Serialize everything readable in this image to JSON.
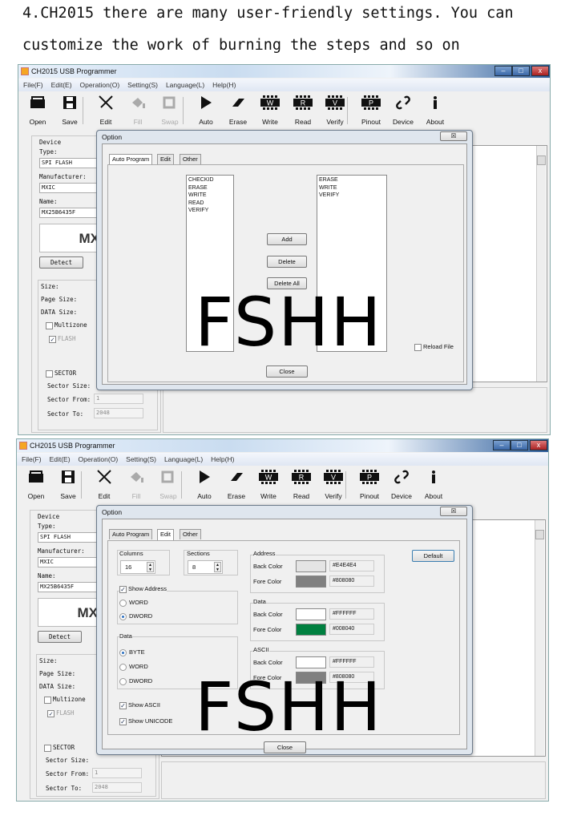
{
  "heading": {
    "line1": "4.CH2015 there are many user-friendly settings. You can",
    "line2": "customize the work of burning the steps and so on"
  },
  "app": {
    "title": "CH2015 USB Programmer",
    "window_controls": [
      "–",
      "□",
      "x"
    ],
    "menu": [
      "File(F)",
      "Edit(E)",
      "Operation(O)",
      "Setting(S)",
      "Language(L)",
      "Help(H)"
    ],
    "toolbar": [
      {
        "label": "Open",
        "icon": "folder-open-icon",
        "disabled": false
      },
      {
        "label": "Save",
        "icon": "floppy-save-icon",
        "disabled": false
      },
      {
        "label": "Edit",
        "icon": "edit-tools-icon",
        "disabled": false
      },
      {
        "label": "Fill",
        "icon": "fill-bucket-icon",
        "disabled": true
      },
      {
        "label": "Swap",
        "icon": "swap-icon",
        "disabled": true
      },
      {
        "label": "Auto",
        "icon": "play-icon",
        "disabled": false
      },
      {
        "label": "Erase",
        "icon": "eraser-icon",
        "disabled": false
      },
      {
        "label": "Write",
        "icon": "chip-w-icon",
        "chip": "W",
        "disabled": false
      },
      {
        "label": "Read",
        "icon": "chip-r-icon",
        "chip": "R",
        "disabled": false
      },
      {
        "label": "Verify",
        "icon": "chip-v-icon",
        "chip": "V",
        "disabled": false
      },
      {
        "label": "Pinout",
        "icon": "chip-p-icon",
        "chip": "P",
        "disabled": false
      },
      {
        "label": "Device",
        "icon": "link-icon",
        "disabled": false
      },
      {
        "label": "About",
        "icon": "info-icon",
        "disabled": false
      }
    ],
    "device": {
      "group_label": "Device",
      "type_label": "Type:",
      "type_value": "SPI FLASH",
      "manufacturer_label": "Manufacturer:",
      "manufacturer_value": "MXIC",
      "name_label": "Name:",
      "name_value": "MX25B6435F",
      "logo": "MX",
      "detect": "Detect",
      "size_label": "Size:",
      "page_size_label": "Page Size:",
      "data_size_label": "DATA Size:",
      "multizone": "Multizone",
      "flash": "FLASH",
      "sector": "SECTOR",
      "sector_size_label": "Sector Size:",
      "sector_from_label": "Sector From:",
      "sector_from_value": "1",
      "sector_to_label": "Sector To:",
      "sector_to_value": "2048"
    }
  },
  "dialog": {
    "title": "Option",
    "close_x": "☒",
    "tabs": [
      "Auto Program",
      "Edit",
      "Other"
    ],
    "close_button": "Close",
    "auto_program": {
      "left_list": [
        "CHECKID",
        "ERASE",
        "WRITE",
        "READ",
        "VERIFY"
      ],
      "right_list": [
        "ERASE",
        "WRITE",
        "VERIFY"
      ],
      "add": "Add",
      "delete": "Delete",
      "delete_all": "Delete All",
      "reload_file": "Reload File",
      "reload_checked": false
    },
    "edit": {
      "columns_label": "Columns",
      "columns_value": "16",
      "sections_label": "Sections",
      "sections_value": "8",
      "show_address": "Show Address",
      "address_word": "WORD",
      "address_dword": "DWORD",
      "address_selected": "DWORD",
      "data_label": "Data",
      "data_byte": "BYTE",
      "data_word": "WORD",
      "data_dword": "DWORD",
      "data_selected": "BYTE",
      "show_ascii": "Show ASCII",
      "show_unicode": "Show UNICODE",
      "default": "Default",
      "back_color_label": "Back Color",
      "fore_color_label": "Fore Color",
      "color_groups": [
        {
          "name": "Address",
          "back": "#E4E4E4",
          "fore": "#808080"
        },
        {
          "name": "Data",
          "back": "#FFFFFF",
          "fore": "#008040"
        },
        {
          "name": "ASCII",
          "back": "#FFFFFF",
          "fore": "#808080"
        }
      ]
    }
  },
  "watermark": "FSHH"
}
